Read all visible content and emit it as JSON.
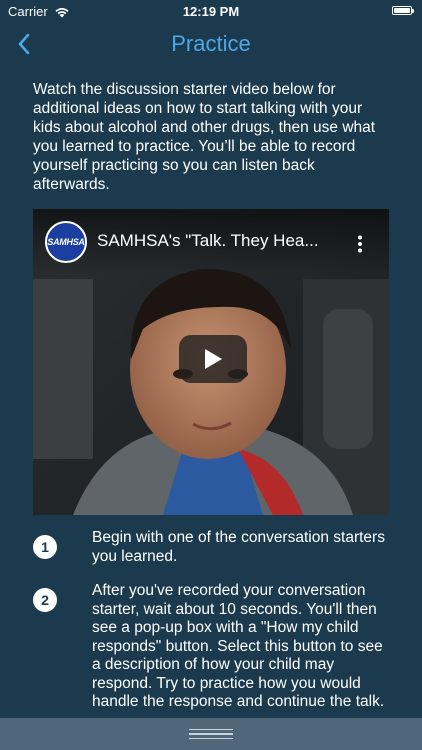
{
  "status_bar": {
    "carrier": "Carrier",
    "time": "12:19 PM"
  },
  "nav": {
    "title": "Practice",
    "back_icon": "chevron-left-icon"
  },
  "intro_text": "Watch the discussion starter video below for additional ideas on how to start talking with your kids about alcohol and other drugs, then use what you learned to practice. You’ll be able to record yourself practicing so you can listen back afterwards.",
  "video": {
    "channel_logo_text": "SAMHSA",
    "title": "SAMHSA's \"Talk. They Hea...",
    "menu_icon": "more-vertical-icon",
    "play_icon": "play-icon"
  },
  "steps": [
    {
      "number": "1",
      "text": "Begin with one of the conversation starters you learned."
    },
    {
      "number": "2",
      "text": "After you've recorded your conversation starter, wait about 10 seconds. You'll then see a pop-up box with a \"How my child responds\" button. Select this button to see a description of how your child may respond. Try to practice how you would handle the response and continue the talk."
    }
  ],
  "colors": {
    "background": "#1c3a4e",
    "accent": "#4aa8e8",
    "bottom_bar": "#50677a"
  }
}
